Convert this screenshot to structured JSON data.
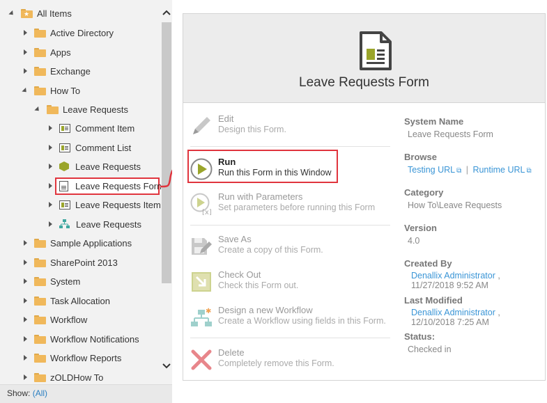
{
  "tree": {
    "items": [
      {
        "label": "All Items",
        "icon": "star-folder-icon",
        "expanded": true
      },
      {
        "label": "Active Directory",
        "icon": "folder-icon",
        "expanded": false
      },
      {
        "label": "Apps",
        "icon": "folder-icon",
        "expanded": false
      },
      {
        "label": "Exchange",
        "icon": "folder-icon",
        "expanded": false
      },
      {
        "label": "How To",
        "icon": "folder-icon",
        "expanded": true
      },
      {
        "label": "Leave Requests",
        "icon": "folder-icon",
        "expanded": true
      },
      {
        "label": "Comment Item",
        "icon": "list-view-icon",
        "expanded": false
      },
      {
        "label": "Comment List",
        "icon": "list-view-icon",
        "expanded": false
      },
      {
        "label": "Leave Requests",
        "icon": "smartobject-icon",
        "expanded": false
      },
      {
        "label": "Leave Requests Form",
        "icon": "form-icon",
        "selected": true
      },
      {
        "label": "Leave Requests Item",
        "icon": "list-view-icon",
        "expanded": false
      },
      {
        "label": "Leave Requests",
        "icon": "workflow-icon",
        "expanded": false
      },
      {
        "label": "Sample Applications",
        "icon": "folder-icon",
        "expanded": false
      },
      {
        "label": "SharePoint 2013",
        "icon": "folder-icon",
        "expanded": false
      },
      {
        "label": "System",
        "icon": "folder-icon",
        "expanded": false
      },
      {
        "label": "Task Allocation",
        "icon": "folder-icon",
        "expanded": false
      },
      {
        "label": "Workflow",
        "icon": "folder-icon",
        "expanded": false
      },
      {
        "label": "Workflow Notifications",
        "icon": "folder-icon",
        "expanded": false
      },
      {
        "label": "Workflow Reports",
        "icon": "folder-icon",
        "expanded": false
      },
      {
        "label": "zOLDHow To",
        "icon": "folder-icon",
        "expanded": false
      }
    ]
  },
  "show_bar": {
    "label": "Show:",
    "value": "(All)"
  },
  "card": {
    "title": "Leave Requests Form",
    "actions": [
      {
        "title": "Edit",
        "desc": "Design this Form.",
        "icon": "pencil-icon"
      },
      {
        "title": "Run",
        "desc": "Run this Form in this Window",
        "icon": "play-icon"
      },
      {
        "title": "Run with Parameters",
        "desc": "Set parameters before running this Form",
        "icon": "play-parameters-icon"
      },
      {
        "title": "Save As",
        "desc": "Create a copy of this Form.",
        "icon": "save-as-icon"
      },
      {
        "title": "Check Out",
        "desc": "Check this Form out.",
        "icon": "check-out-icon"
      },
      {
        "title": "Design a new Workflow",
        "desc": "Create a Workflow using fields in this Form.",
        "icon": "workflow-design-icon"
      },
      {
        "title": "Delete",
        "desc": "Completely remove this Form.",
        "icon": "delete-x-icon"
      }
    ],
    "properties": {
      "system_name": {
        "label": "System Name",
        "value": "Leave Requests Form"
      },
      "browse": {
        "label": "Browse",
        "testing": "Testing URL",
        "separator": "|",
        "runtime": "Runtime URL"
      },
      "category": {
        "label": "Category",
        "value": "How To\\Leave Requests"
      },
      "version": {
        "label": "Version",
        "value": "4.0"
      },
      "created_by": {
        "label": "Created By",
        "user": "Denallix Administrator",
        "comma": ",",
        "date": "11/27/2018 9:52 AM"
      },
      "last_modified": {
        "label": "Last Modified",
        "user": "Denallix Administrator",
        "comma": ",",
        "date": "12/10/2018 7:25 AM"
      },
      "status": {
        "label": "Status:",
        "value": "Checked in"
      }
    }
  },
  "colors": {
    "accent_olive": "#9aa52b",
    "link_blue": "#3a95d6",
    "highlight_red": "#e0343d",
    "folder": "#f0b85b"
  }
}
